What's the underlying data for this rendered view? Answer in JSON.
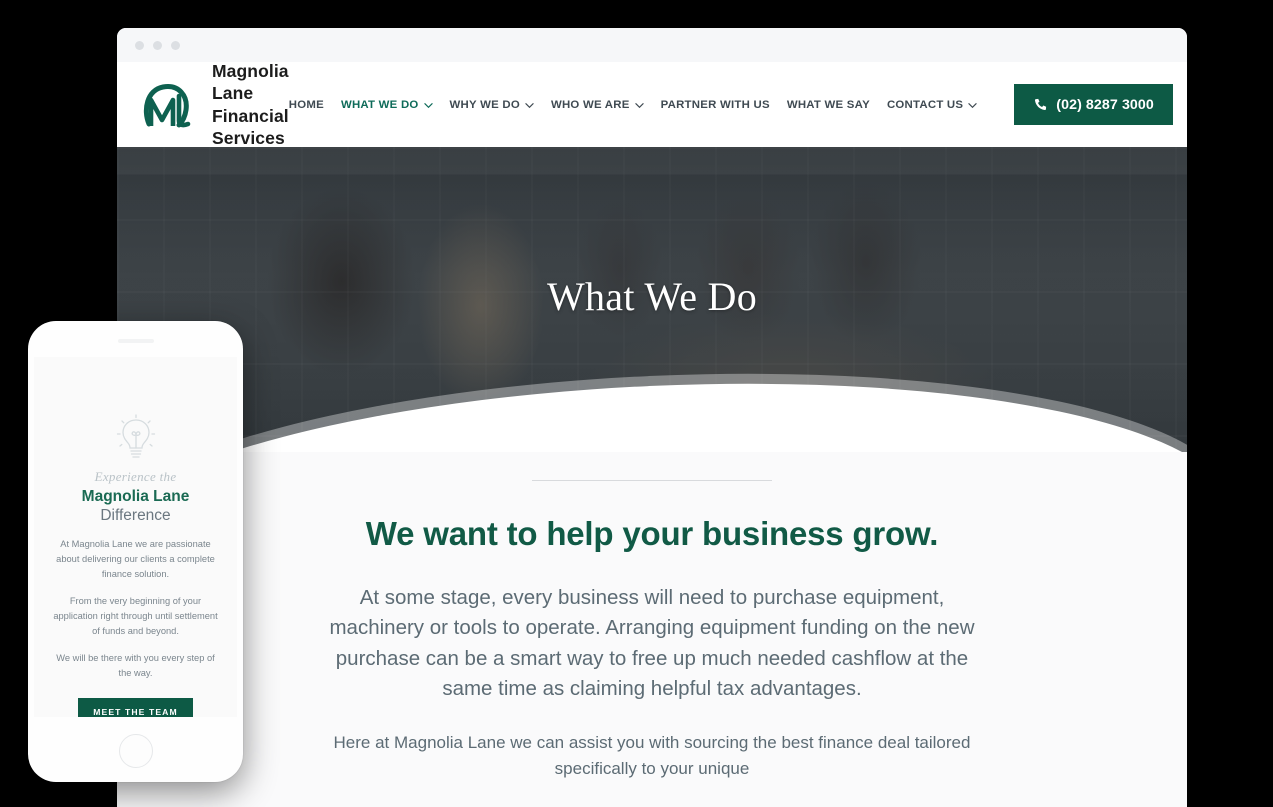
{
  "browser": {
    "dots": [
      "dot-red",
      "dot-yellow",
      "dot-green"
    ]
  },
  "header": {
    "logo_icon": "ml-monogram-logo",
    "brand_name": "Magnolia Lane\nFinancial Services",
    "nav": [
      {
        "label": "HOME",
        "has_caret": false,
        "active": false
      },
      {
        "label": "WHAT WE DO",
        "has_caret": true,
        "active": true
      },
      {
        "label": "WHY WE DO",
        "has_caret": true,
        "active": false
      },
      {
        "label": "WHO WE ARE",
        "has_caret": true,
        "active": false
      },
      {
        "label": "PARTNER WITH US",
        "has_caret": false,
        "active": false
      },
      {
        "label": "WHAT WE SAY",
        "has_caret": false,
        "active": false
      },
      {
        "label": "CONTACT US",
        "has_caret": true,
        "active": false
      }
    ],
    "phone_button": {
      "label": "(02) 8287 3000",
      "icon": "phone-icon",
      "color": "#0d5a45"
    }
  },
  "hero": {
    "title": "What We Do",
    "image_alt": "office-team-meeting-photo"
  },
  "main": {
    "heading": "We want to help your business grow.",
    "heading_color": "#115a46",
    "paragraph": "At some stage, every business will need to purchase equipment, machinery or tools to operate. Arranging equipment funding on the new purchase can be a smart way to free up much needed cashflow at the same time as claiming helpful tax advantages.",
    "paragraph_2": "Here at Magnolia Lane we can assist you with sourcing the best finance deal tailored specifically to your unique"
  },
  "phone_mockup": {
    "icon": "lightbulb-icon",
    "eyebrow": "Experience the",
    "title_line1": "Magnolia Lane",
    "title_line2": "Difference",
    "paragraph_1": "At Magnolia Lane we are passionate about delivering our clients a complete finance solution.",
    "paragraph_2": "From the very beginning of your application right through until settlement of funds and beyond.",
    "paragraph_3": "We will be there with you every step of the way.",
    "cta_label": "MEET THE TEAM",
    "cta_color": "#0d5a45"
  }
}
